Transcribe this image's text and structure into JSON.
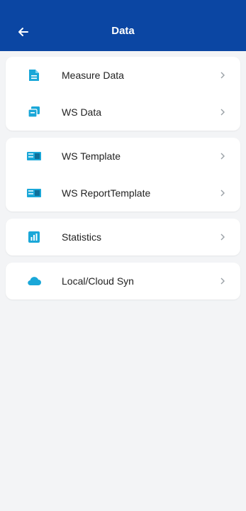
{
  "header": {
    "title": "Data",
    "back_icon": "arrow-left-icon"
  },
  "sections": [
    {
      "items": [
        {
          "label": "Measure Data",
          "icon": "document-icon"
        },
        {
          "label": "WS Data",
          "icon": "stacked-cards-icon"
        }
      ]
    },
    {
      "items": [
        {
          "label": "WS Template",
          "icon": "template-icon"
        },
        {
          "label": "WS ReportTemplate",
          "icon": "report-template-icon"
        }
      ]
    },
    {
      "items": [
        {
          "label": "Statistics",
          "icon": "statistics-icon"
        }
      ]
    },
    {
      "items": [
        {
          "label": "Local/Cloud Syn",
          "icon": "cloud-icon"
        }
      ]
    }
  ],
  "colors": {
    "appbar": "#0b46a3",
    "icon_accent": "#1aa7d8",
    "background": "#f3f4f6"
  }
}
